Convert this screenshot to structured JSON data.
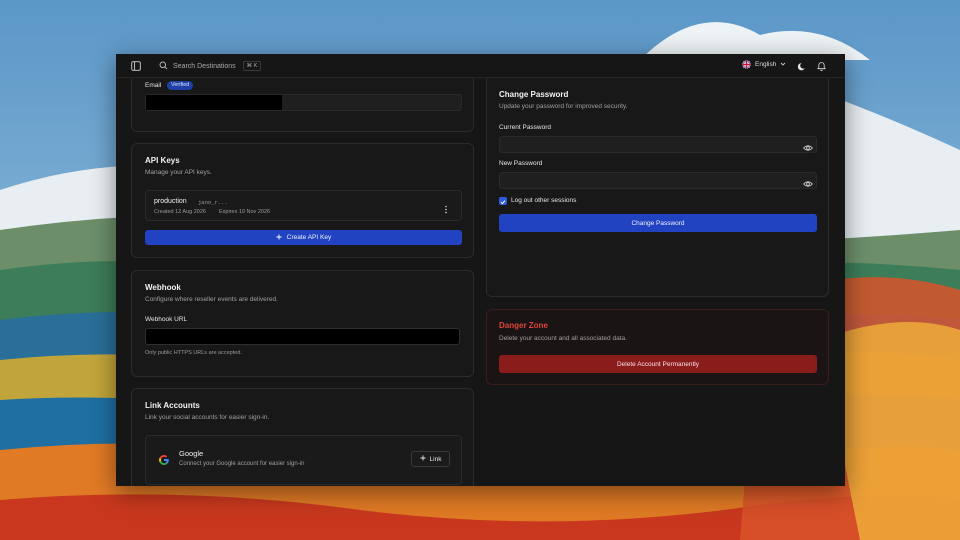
{
  "topbar": {
    "search_placeholder": "Search Destinations",
    "search_shortcut": "⌘ K",
    "language": "English"
  },
  "email_card": {
    "label": "Email",
    "badge": "Verified"
  },
  "api_keys": {
    "title": "API Keys",
    "description": "Manage your API keys.",
    "keys": [
      {
        "name": "production",
        "prefix": "jano_r...",
        "created": "Created 12 Aug 2026",
        "expires": "Expires 10 Nov 2026"
      }
    ],
    "create_button": "Create API Key"
  },
  "webhook": {
    "title": "Webhook",
    "description": "Configure where reseller events are delivered.",
    "url_label": "Webhook URL",
    "hint": "Only public HTTPS URLs are accepted."
  },
  "link_accounts": {
    "title": "Link Accounts",
    "description": "Link your social accounts for easier sign-in.",
    "providers": [
      {
        "name": "Google",
        "description": "Connect your Google account for easier sign-in",
        "button": "Link"
      }
    ]
  },
  "change_password": {
    "title": "Change Password",
    "description": "Update your password for improved security.",
    "current_label": "Current Password",
    "new_label": "New Password",
    "logout_label": "Log out other sessions",
    "logout_checked": true,
    "submit": "Change Password"
  },
  "danger_zone": {
    "title": "Danger Zone",
    "description": "Delete your account and all associated data.",
    "button": "Delete Account Permanently"
  },
  "colors": {
    "accent": "#2143c2",
    "danger": "#8b1c1c",
    "danger_text": "#e0443a"
  }
}
